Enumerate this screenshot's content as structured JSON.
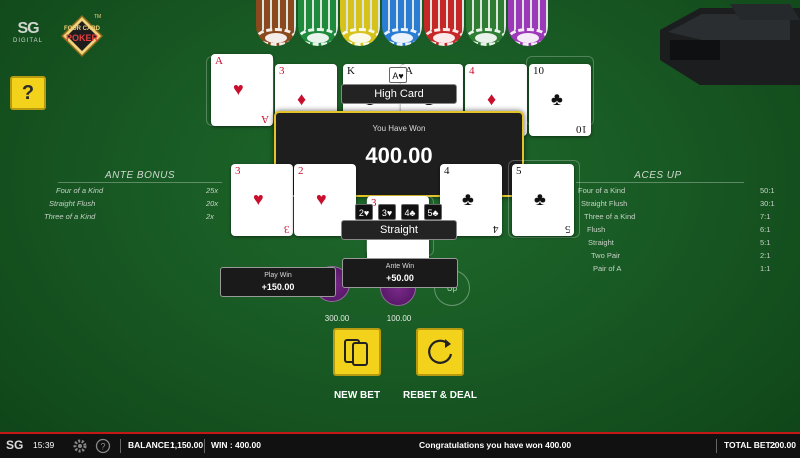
{
  "branding": {
    "sg_logo": "SG",
    "sg_sub": "DIGITAL",
    "game_logo_top": "FOUR CARD",
    "game_logo_main": "POKER",
    "tm": "TM"
  },
  "help_button": "?",
  "chip_colors": [
    "#8a4a1e",
    "#1e8a3c",
    "#d6c21a",
    "#2b7cd3",
    "#c62828",
    "#2e7d32",
    "#9c39b8"
  ],
  "dealer_cards": [
    {
      "rank": "A",
      "suit": "♥",
      "color": "red"
    },
    {
      "rank": "3",
      "suit": "♦",
      "color": "red"
    },
    {
      "rank": "K",
      "suit": "♠",
      "color": "black"
    },
    {
      "rank": "A",
      "suit": "♣",
      "color": "black"
    },
    {
      "rank": "4",
      "suit": "♦",
      "color": "red"
    },
    {
      "rank": "10",
      "suit": "♣",
      "color": "black"
    }
  ],
  "dealer_hand": {
    "mini_card": "A♥",
    "label": "High Card"
  },
  "player_cards": [
    {
      "rank": "3",
      "suit": "♥",
      "color": "red"
    },
    {
      "rank": "2",
      "suit": "♥",
      "color": "red"
    },
    {
      "rank": "3",
      "suit": "♥",
      "color": "red"
    },
    {
      "rank": "4",
      "suit": "♣",
      "color": "black"
    },
    {
      "rank": "5",
      "suit": "♣",
      "color": "black"
    }
  ],
  "player_hand": {
    "mini_cards": [
      "2♥",
      "3♥",
      "4♣",
      "5♣"
    ],
    "label": "Straight"
  },
  "win_box": {
    "title": "You Have Won",
    "amount": "400.00"
  },
  "ante_bonus": {
    "title": "ANTE BONUS",
    "rows": [
      {
        "hand": "Four of a Kind",
        "pay": "25x"
      },
      {
        "hand": "Straight Flush",
        "pay": "20x"
      },
      {
        "hand": "Three of a Kind",
        "pay": "2x"
      }
    ]
  },
  "aces_up": {
    "title": "ACES UP",
    "rows": [
      {
        "hand": "Four of a Kind",
        "pay": "50:1"
      },
      {
        "hand": "Straight Flush",
        "pay": "30:1"
      },
      {
        "hand": "Three of a Kind",
        "pay": "7:1"
      },
      {
        "hand": "Flush",
        "pay": "6:1"
      },
      {
        "hand": "Straight",
        "pay": "5:1"
      },
      {
        "hand": "Two Pair",
        "pay": "2:1"
      },
      {
        "hand": "Pair of A",
        "pay": "1:1"
      }
    ]
  },
  "play_win": {
    "label": "Play Win",
    "value": "+150.00"
  },
  "ante_win": {
    "label": "Ante Win",
    "value": "+50.00"
  },
  "bet_spots": {
    "play_amount": "300.00",
    "ante_amount": "100.00",
    "aces_up_label": "Up"
  },
  "actions": {
    "new_bet": "NEW BET",
    "rebet_deal": "REBET & DEAL"
  },
  "status_bar": {
    "logo": "SG",
    "time": "15:39",
    "balance_label": "BALANCE :",
    "balance_value": "1,150.00",
    "win_label": "WIN :",
    "win_value": "400.00",
    "message": "Congratulations you have won 400.00",
    "total_bet_label": "TOTAL BET :",
    "total_bet_value": "200.00"
  },
  "colors": {
    "felt": "#175622",
    "accent_yellow": "#f3d21c",
    "win_border": "#e4c32a",
    "status_red": "#c21818"
  }
}
